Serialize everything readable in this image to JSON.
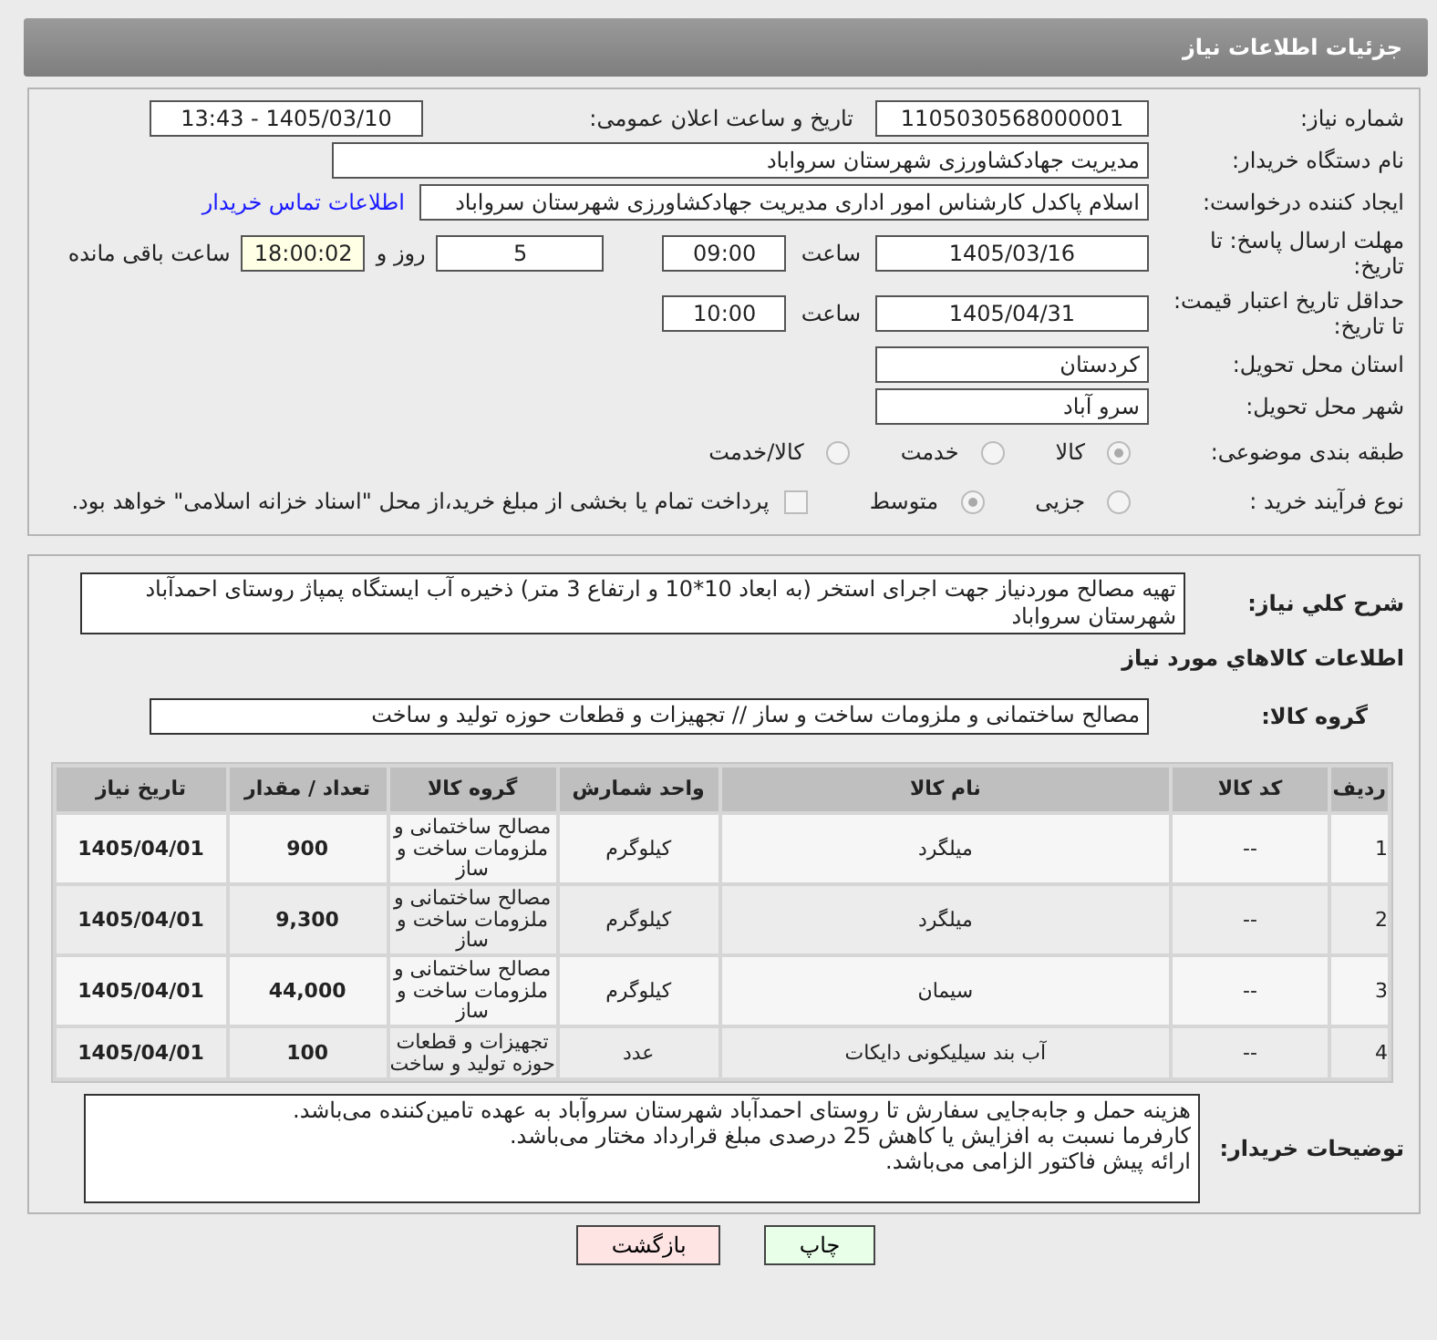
{
  "header": {
    "title": "جزئیات اطلاعات نیاز"
  },
  "need_number": {
    "label": "شماره نیاز:",
    "value": "1105030568000001"
  },
  "announce_datetime": {
    "label": "تاریخ و ساعت اعلان عمومی:",
    "value": "1405/03/10 - 13:43"
  },
  "buyer_org": {
    "label": "نام دستگاه خریدار:",
    "value": "مدیریت جهادکشاورزی شهرستان سرواباد"
  },
  "requester": {
    "label": "ایجاد کننده درخواست:",
    "value": "اسلام پاکدل کارشناس امور اداری مدیریت جهادکشاورزی شهرستان سرواباد",
    "link": "اطلاعات تماس خریدار"
  },
  "reply_deadline": {
    "label": "مهلت ارسال پاسخ: تا تاریخ:",
    "date": "1405/03/16",
    "time_label": "ساعت",
    "time": "09:00",
    "days": "5",
    "days_label": "روز و",
    "remaining": "18:00:02",
    "remaining_label": "ساعت باقی مانده"
  },
  "price_validity": {
    "label": "حداقل تاریخ اعتبار قیمت: تا تاریخ:",
    "date": "1405/04/31",
    "time_label": "ساعت",
    "time": "10:00"
  },
  "province": {
    "label": "استان محل تحویل:",
    "value": "کردستان"
  },
  "city": {
    "label": "شهر محل تحویل:",
    "value": "سرو آباد"
  },
  "category": {
    "label": "طبقه بندی موضوعی:",
    "options": [
      {
        "label": "کالا",
        "selected": true
      },
      {
        "label": "خدمت",
        "selected": false
      },
      {
        "label": "کالا/خدمت",
        "selected": false
      }
    ]
  },
  "purchase_process": {
    "label": "نوع فرآیند خرید :",
    "options": [
      {
        "label": "جزیی",
        "selected": false
      },
      {
        "label": "متوسط",
        "selected": true
      }
    ],
    "payment_note": {
      "checked": false,
      "text": "پرداخت تمام یا بخشی از مبلغ خرید،از محل \"اسناد خزانه اسلامی\" خواهد بود."
    }
  },
  "description": {
    "label": "شرح کلي نياز:",
    "value": "تهیه مصالح موردنیاز جهت اجرای استخر (به ابعاد 10*10 و ارتفاع 3 متر) ذخیره آب ایستگاه پمپاژ روستای احمدآباد شهرستان سرواباد"
  },
  "goods_section_title": "اطلاعات کالاهاي مورد نياز",
  "goods_group": {
    "label": "گروه کالا:",
    "value": "مصالح ساختمانی و ملزومات ساخت و ساز // تجهیزات و قطعات حوزه تولید و ساخت"
  },
  "table": {
    "columns": [
      "ردیف",
      "کد کالا",
      "نام کالا",
      "واحد شمارش",
      "گروه کالا",
      "تعداد / مقدار",
      "تاریخ نیاز"
    ],
    "rows": [
      [
        "1",
        "--",
        "میلگرد",
        "کیلوگرم",
        "مصالح ساختمانی و ملزومات ساخت و ساز",
        "900",
        "1405/04/01"
      ],
      [
        "2",
        "--",
        "میلگرد",
        "کیلوگرم",
        "مصالح ساختمانی و ملزومات ساخت و ساز",
        "9,300",
        "1405/04/01"
      ],
      [
        "3",
        "--",
        "سیمان",
        "کیلوگرم",
        "مصالح ساختمانی و ملزومات ساخت و ساز",
        "44,000",
        "1405/04/01"
      ],
      [
        "4",
        "--",
        "آب بند سیلیکونی دایکات",
        "عدد",
        "تجهیزات و قطعات حوزه تولید و ساخت",
        "100",
        "1405/04/01"
      ]
    ]
  },
  "buyer_notes": {
    "label": "توضیحات خریدار:",
    "lines": [
      "هزینه حمل و جابه‌جایی سفارش تا روستای احمدآباد شهرستان سروآباد به عهده تامین‌کننده می‌باشد.",
      "کارفرما نسبت به افزایش یا کاهش 25 درصدی مبلغ قرارداد مختار می‌باشد.",
      "ارائه پیش فاکتور الزامی می‌باشد."
    ]
  },
  "buttons": [
    {
      "label": "چاپ",
      "kind": "print"
    },
    {
      "label": "بازگشت",
      "kind": "back"
    }
  ]
}
